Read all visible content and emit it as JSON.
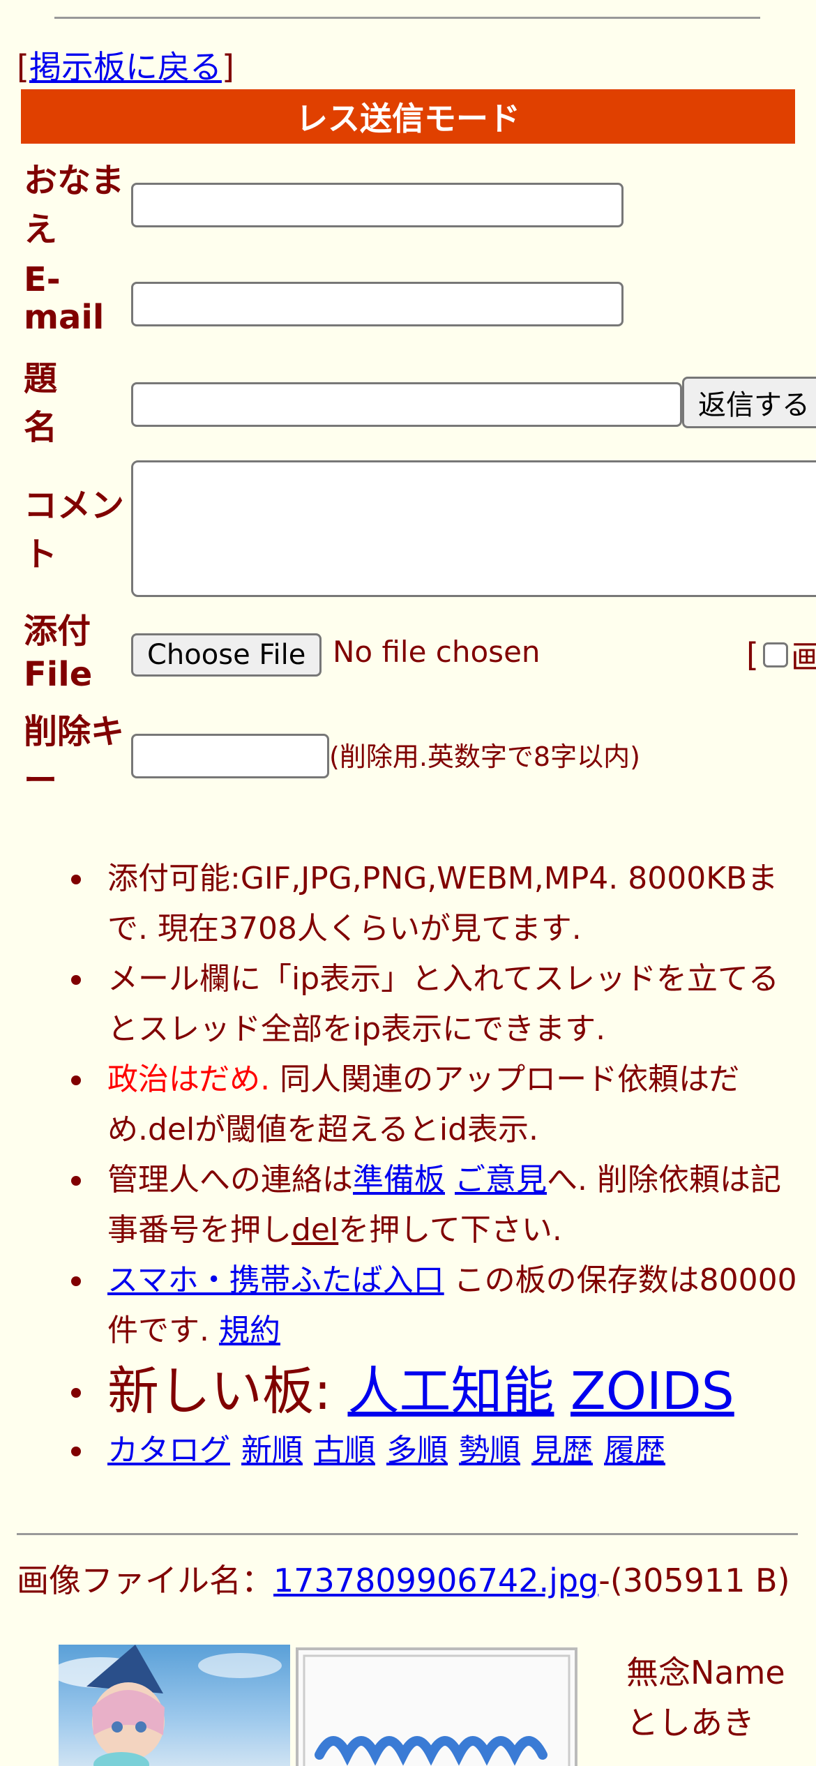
{
  "nav": {
    "back_open": "[",
    "back_label": "掲示板に戻る",
    "back_close": "]"
  },
  "form": {
    "mode_title": "レス送信モード",
    "name_label": "おなまえ",
    "email_label": "E-mail",
    "subject_label": "題名",
    "submit_label": "返信する",
    "comment_label": "コメント",
    "attach_label": "添付File",
    "choose_file_label": "Choose File",
    "no_file_text": "No file chosen",
    "image_option_bracket": "[",
    "image_option_char": "画",
    "delete_key_label": "削除キー",
    "delete_key_note": "(削除用.英数字で8字以内)"
  },
  "notes": {
    "line1": "添付可能:GIF,JPG,PNG,WEBM,MP4. 8000KBまで. 現在3708人くらいが見てます.",
    "line2": "メール欄に「ip表示」と入れてスレッドを立てるとスレッド全部をip表示にできます.",
    "line3_red": "政治はだめ.",
    "line3_rest": " 同人関連のアップロード依頼はだめ.delが閾値を超えるとid表示.",
    "line4_a": "管理人への連絡は",
    "line4_link1": "準備板",
    "line4_link2": "ご意見",
    "line4_b": "へ. 削除依頼は記事番号を押し",
    "line4_del": "del",
    "line4_c": "を押して下さい.",
    "line5_link": "スマホ・携帯ふたば入口",
    "line5_a": " この板の保存数は80000件です. ",
    "line5_terms": "規約",
    "line6_label": "新しい板: ",
    "line6_link1": "人工知能",
    "line6_link2": "ZOIDS",
    "nav_links": [
      "カタログ",
      "新順",
      "古順",
      "多順",
      "勢順",
      "見歴",
      "履歴"
    ]
  },
  "post": {
    "file_label": "画像ファイル名：",
    "file_name": "1737809906742.jpg",
    "file_size": "-(305911 B)",
    "name_line1": "無念Name",
    "name_line2": "としあき"
  },
  "colors": {
    "background": "#ffffee",
    "text": "#800000",
    "banner": "#e04000",
    "link": "#0000ee",
    "warning": "#ff0000"
  }
}
